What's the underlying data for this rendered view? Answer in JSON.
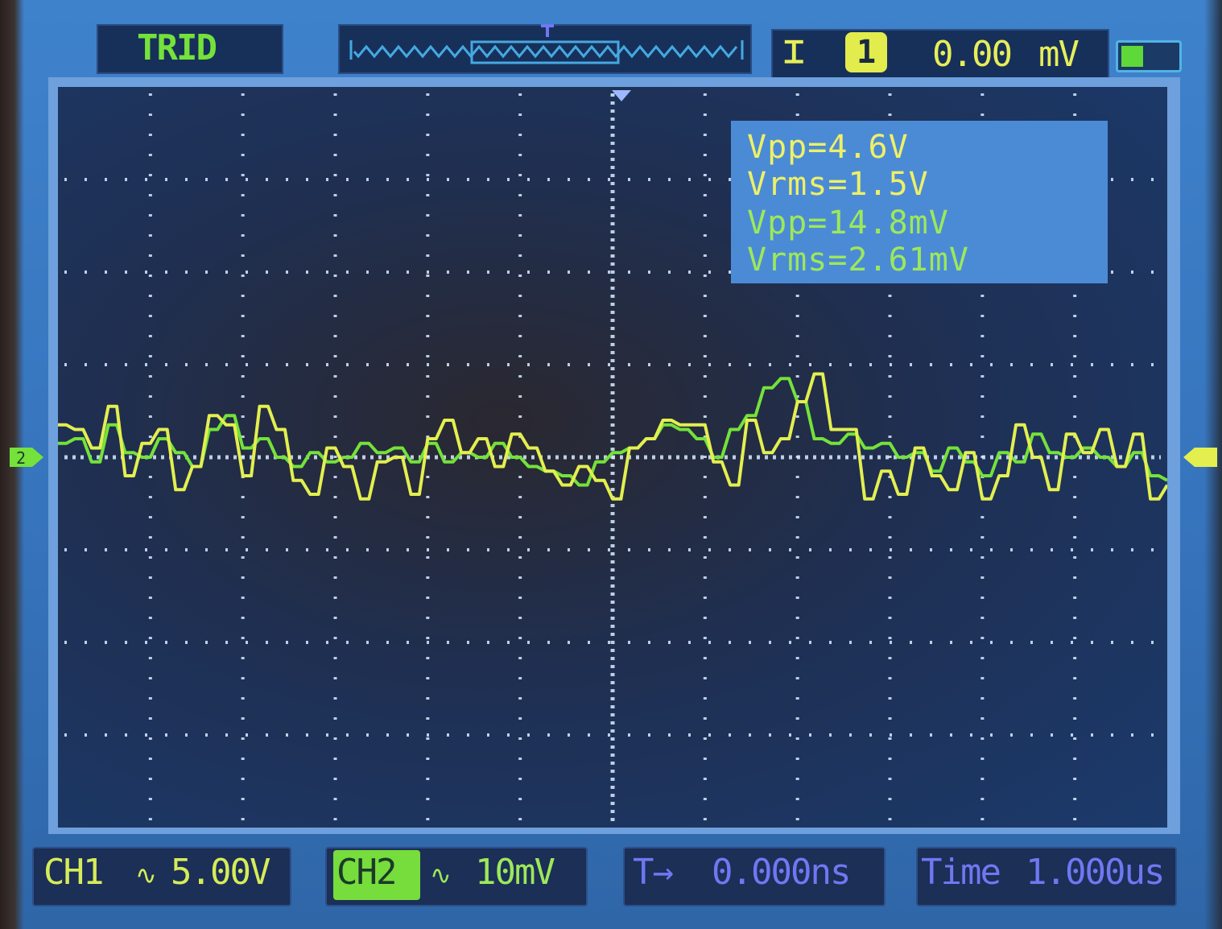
{
  "header": {
    "trigger_status": "TRID",
    "channel_icon": "Ꮖ",
    "channel_number": "1",
    "offset_value": "0.00",
    "offset_unit": "mV",
    "battery_level": 0.4
  },
  "measurements": {
    "ch1_vpp": "Vpp=4.6V",
    "ch1_vrms": "Vrms=1.5V",
    "ch2_vpp": "Vpp=14.8mV",
    "ch2_vrms": "Vrms=2.61mV"
  },
  "footer": {
    "ch1_label": "CH1",
    "ch1_coupling": "∿",
    "ch1_scale": "5.00V",
    "ch2_label": "CH2",
    "ch2_coupling": "∿",
    "ch2_scale": "10mV",
    "trigger_offset_label": "T→",
    "trigger_offset_value": "0.000ns",
    "timebase_label": "Time",
    "timebase_value": "1.000us"
  },
  "colors": {
    "ch1": "#e3ef4f",
    "ch2": "#74e23a",
    "grid": "#d8ecff"
  },
  "icons": {
    "channel_icon": "channel-indicator-icon",
    "trigger_marker": "trigger-position-icon",
    "ch1_marker": "ch1-ground-marker-icon",
    "ch2_marker": "ch2-ground-marker-icon"
  },
  "chart_data": {
    "type": "line",
    "grid": true,
    "grid_divisions": {
      "x": 12,
      "y": 8
    },
    "series": [
      {
        "name": "CH1",
        "values": [
          0.35,
          0.3,
          0.1,
          0.55,
          -0.2,
          0.15,
          0.3,
          -0.35,
          -0.1,
          0.45,
          0.35,
          -0.2,
          0.55,
          0.3,
          -0.25,
          -0.4,
          0.1,
          -0.1,
          -0.45,
          -0.05,
          0.0,
          -0.4,
          0.2,
          0.4,
          0.05,
          0.2,
          -0.1,
          0.25,
          0.1,
          -0.15,
          -0.3,
          -0.1,
          -0.25,
          -0.45,
          0.1,
          0.2,
          0.4,
          0.35,
          0.35,
          -0.05,
          -0.3,
          0.4,
          0.05,
          0.2,
          0.6,
          0.9,
          0.3,
          0.3,
          -0.45,
          -0.15,
          -0.4,
          0.1,
          -0.2,
          -0.35,
          0.05,
          -0.45,
          -0.2,
          0.35,
          0.0,
          -0.35,
          0.25,
          0.05,
          0.3,
          -0.1,
          0.25,
          -0.45,
          -0.3
        ]
      },
      {
        "name": "CH2",
        "values": [
          0.15,
          0.2,
          -0.05,
          0.35,
          0.05,
          0.0,
          0.2,
          0.05,
          -0.1,
          0.3,
          0.45,
          0.1,
          0.2,
          0.0,
          -0.1,
          0.05,
          -0.05,
          0.0,
          0.15,
          0.05,
          0.1,
          -0.05,
          0.15,
          -0.05,
          0.05,
          0.0,
          0.15,
          0.0,
          -0.1,
          -0.15,
          -0.2,
          -0.3,
          -0.05,
          0.05,
          0.1,
          0.2,
          0.35,
          0.3,
          0.2,
          0.0,
          0.3,
          0.45,
          0.75,
          0.85,
          0.6,
          0.2,
          0.15,
          0.25,
          0.1,
          0.15,
          0.0,
          0.05,
          -0.15,
          0.1,
          -0.05,
          -0.2,
          0.05,
          -0.05,
          0.25,
          0.05,
          0.0,
          0.1,
          0.0,
          -0.1,
          0.05,
          -0.2,
          -0.25
        ]
      }
    ]
  }
}
